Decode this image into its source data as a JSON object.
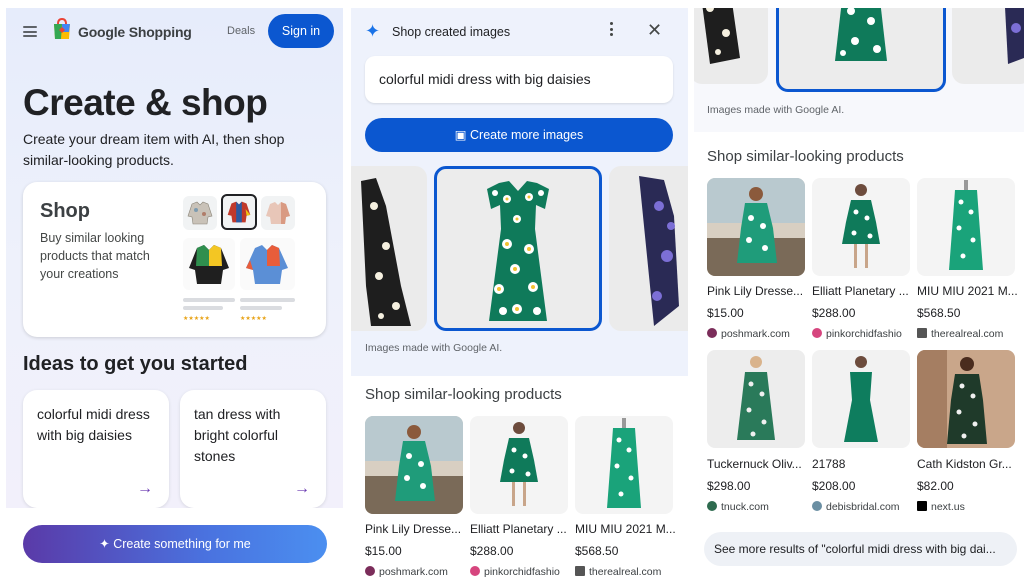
{
  "panel1": {
    "brand": "Google Shopping",
    "deals": "Deals",
    "sign_in": "Sign in",
    "hero_title": "Create & shop",
    "hero_subtitle": "Create your dream item with AI, then shop similar-looking products.",
    "shop_card": {
      "title": "Shop",
      "description": "Buy similar looking products that match your creations",
      "stars": "★★★★★"
    },
    "ideas_title": "Ideas to get you started",
    "ideas": [
      {
        "text": "colorful midi dress with big daisies",
        "arrow": "→"
      },
      {
        "text": "tan dress with bright colorful stones",
        "arrow": "→"
      }
    ],
    "create_button": "Create something for me"
  },
  "panel2": {
    "title": "Shop created images",
    "query": "colorful midi dress with big daisies",
    "create_more": "Create more images",
    "caption": "Images made with Google AI.",
    "section_title": "Shop similar-looking products",
    "products": [
      {
        "name": "Pink Lily Dresse...",
        "price": "$15.00",
        "store": "poshmark.com",
        "store_color": "#7b2d5a"
      },
      {
        "name": "Elliatt Planetary ...",
        "price": "$288.00",
        "store": "pinkorchidfashio",
        "store_color": "#d6457e"
      },
      {
        "name": "MIU MIU 2021 M...",
        "price": "$568.50",
        "store": "therealreal.com",
        "store_color": "#555555"
      }
    ]
  },
  "panel3": {
    "caption": "Images made with Google AI.",
    "section_title": "Shop similar-looking products",
    "products": [
      {
        "name": "Pink Lily Dresse...",
        "price": "$15.00",
        "store": "poshmark.com",
        "store_color": "#7b2d5a"
      },
      {
        "name": "Elliatt Planetary ...",
        "price": "$288.00",
        "store": "pinkorchidfashio",
        "store_color": "#d6457e"
      },
      {
        "name": "MIU MIU 2021 M...",
        "price": "$568.50",
        "store": "therealreal.com",
        "store_color": "#555555"
      },
      {
        "name": "Tuckernuck Oliv...",
        "price": "$298.00",
        "store": "tnuck.com",
        "store_color": "#2e6b4f"
      },
      {
        "name": "21788",
        "price": "$208.00",
        "store": "debisbridal.com",
        "store_color": "#6b8fa3"
      },
      {
        "name": "Cath Kidston Gr...",
        "price": "$82.00",
        "store": "next.us",
        "store_color": "#000000"
      }
    ],
    "see_more": "See more results of \"colorful midi dress with big dai..."
  },
  "colors": {
    "primary_blue": "#0b57d0",
    "dress_green": "#0f7a5a"
  }
}
